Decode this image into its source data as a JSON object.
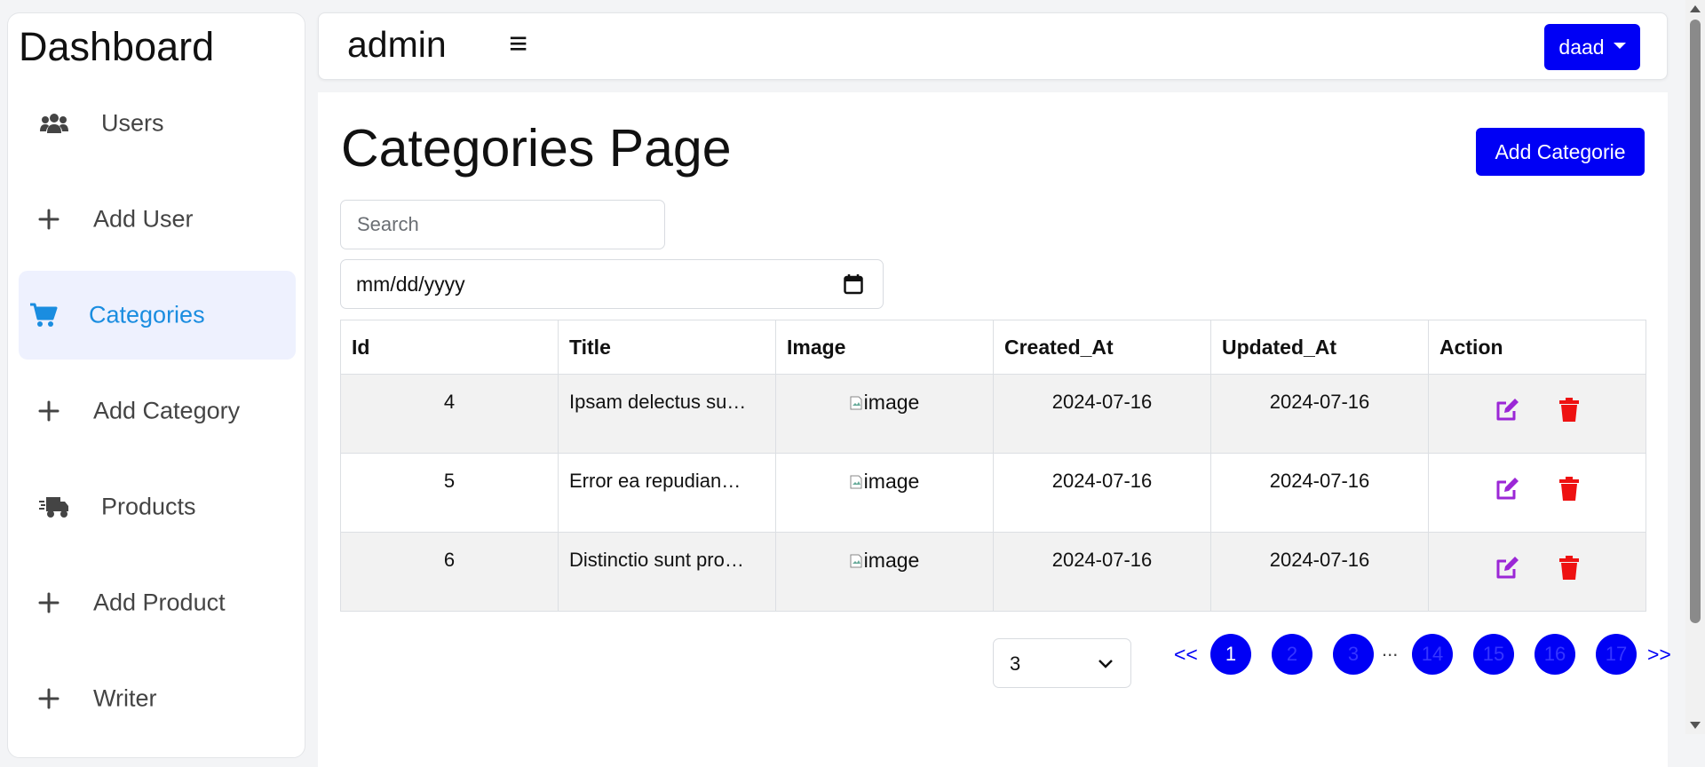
{
  "sidebar": {
    "title": "Dashboard",
    "items": [
      {
        "label": "Users",
        "icon": "users-icon"
      },
      {
        "label": "Add User",
        "icon": "plus-icon"
      },
      {
        "label": "Categories",
        "icon": "cart-icon",
        "active": true
      },
      {
        "label": "Add Category",
        "icon": "plus-icon"
      },
      {
        "label": "Products",
        "icon": "truck-icon"
      },
      {
        "label": "Add Product",
        "icon": "plus-icon"
      },
      {
        "label": "Writer",
        "icon": "plus-icon"
      }
    ]
  },
  "topbar": {
    "title": "admin",
    "menu_icon": "≡",
    "user_label": "daad"
  },
  "main": {
    "page_title": "Categories Page",
    "add_button_label": "Add Categorie",
    "search_placeholder": "Search",
    "date_placeholder": "mm/dd/yyyy"
  },
  "table": {
    "columns": [
      "Id",
      "Title",
      "Image",
      "Created_At",
      "Updated_At",
      "Action"
    ],
    "rows": [
      {
        "id": "4",
        "title": "Ipsam delectus su…",
        "image_alt": "image",
        "created_at": "2024-07-16",
        "updated_at": "2024-07-16"
      },
      {
        "id": "5",
        "title": "Error ea repudian…",
        "image_alt": "image",
        "created_at": "2024-07-16",
        "updated_at": "2024-07-16"
      },
      {
        "id": "6",
        "title": "Distinctio sunt pro…",
        "image_alt": "image",
        "created_at": "2024-07-16",
        "updated_at": "2024-07-16"
      }
    ]
  },
  "pagination": {
    "per_page": "3",
    "prev_label": "<<",
    "next_label": ">>",
    "pages": [
      "1",
      "2",
      "3",
      "14",
      "15",
      "16",
      "17"
    ],
    "current_page": "1",
    "ellipsis": "..."
  },
  "colors": {
    "primary": "#0000f5",
    "active_nav_bg": "#eef1fe",
    "active_nav_text": "#1a8de0",
    "edit_icon": "#9b27d6",
    "delete_icon": "#ee1111"
  }
}
